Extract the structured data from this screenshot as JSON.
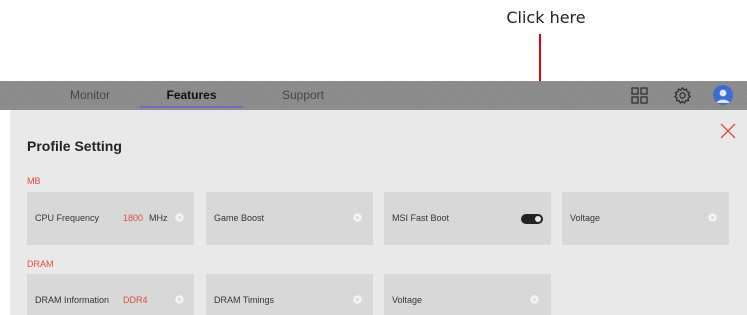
{
  "annotation": {
    "callout_text": "Click here",
    "color": "#e00012"
  },
  "nav": {
    "tabs": [
      {
        "label": "Monitor",
        "active": false
      },
      {
        "label": "Features",
        "active": true
      },
      {
        "label": "Support",
        "active": false
      }
    ],
    "icons": [
      "grid-icon",
      "gear-icon",
      "avatar"
    ],
    "accent": "#7a6ac8"
  },
  "panel": {
    "title": "Profile Setting",
    "close_icon": "close-icon",
    "sections": [
      {
        "label": "MB",
        "cards": [
          {
            "label": "CPU Frequency",
            "value": "1800",
            "unit": "MHz",
            "control": "gear-icon"
          },
          {
            "label": "Game Boost",
            "control": "gear-icon"
          },
          {
            "label": "MSI Fast Boot",
            "control": "toggle",
            "toggle_on": true
          },
          {
            "label": "Voltage",
            "control": "gear-icon"
          }
        ]
      },
      {
        "label": "DRAM",
        "cards": [
          {
            "label": "DRAM Information",
            "value": "DDR4",
            "control": "gear-icon"
          },
          {
            "label": "DRAM Timings",
            "control": "gear-icon"
          },
          {
            "label": "Voltage",
            "control": "gear-icon"
          }
        ]
      }
    ]
  }
}
